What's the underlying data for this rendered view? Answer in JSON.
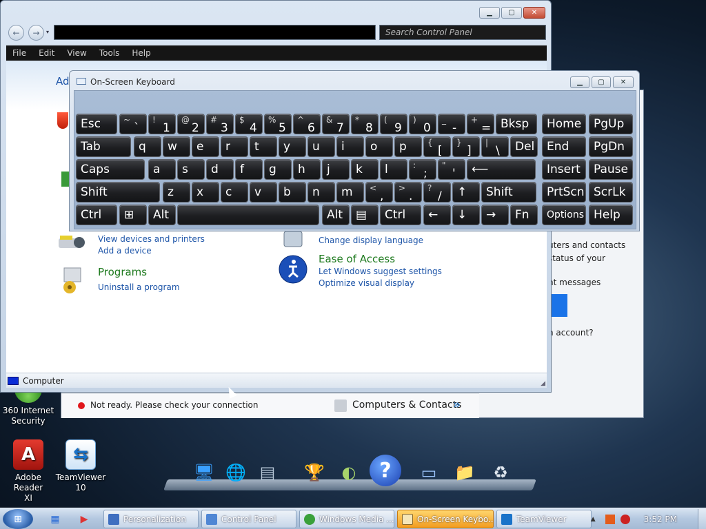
{
  "desktop": {
    "icons": [
      {
        "label_line1": "360 Internet",
        "label_line2": "Security"
      },
      {
        "label_line1": "Adobe Reader",
        "label_line2": "XI"
      },
      {
        "label_line1": "TeamViewer",
        "label_line2": "10"
      }
    ]
  },
  "control_panel": {
    "search_placeholder": "Search Control Panel",
    "menu": [
      "File",
      "Edit",
      "View",
      "Tools",
      "Help"
    ],
    "adjust_partial": "Adj",
    "hardware": {
      "link1": "View devices and printers",
      "link2": "Add a device"
    },
    "programs": {
      "title": "Programs",
      "link1": "Uninstall a program"
    },
    "clock": {
      "link1": "Change display language"
    },
    "ease": {
      "title": "Ease of Access",
      "link1": "Let Windows suggest settings",
      "link2": "Optimize visual display"
    },
    "status": "Computer"
  },
  "teamviewer": {
    "line1": "uters and contacts",
    "line2": "status of your",
    "line3": "nt messages",
    "line4": "n account?",
    "status_text": "Not ready. Please check your connection",
    "contacts_label": "Computers & Contacts",
    "contacts_chevron": "»"
  },
  "osk": {
    "title": "On-Screen Keyboard",
    "row1": [
      {
        "label": "Esc"
      },
      {
        "sub": "~",
        "main": "`"
      },
      {
        "sub": "!",
        "main": "1"
      },
      {
        "sub": "@",
        "main": "2"
      },
      {
        "sub": "#",
        "main": "3"
      },
      {
        "sub": "$",
        "main": "4"
      },
      {
        "sub": "%",
        "main": "5"
      },
      {
        "sub": "^",
        "main": "6"
      },
      {
        "sub": "&",
        "main": "7"
      },
      {
        "sub": "*",
        "main": "8"
      },
      {
        "sub": "(",
        "main": "9"
      },
      {
        "sub": ")",
        "main": "0"
      },
      {
        "sub": "_",
        "main": "-"
      },
      {
        "sub": "+",
        "main": "="
      },
      {
        "label": "Bksp"
      },
      {
        "label": "Home"
      },
      {
        "label": "PgUp"
      }
    ],
    "row2": [
      {
        "label": "Tab"
      },
      {
        "label": "q"
      },
      {
        "label": "w"
      },
      {
        "label": "e"
      },
      {
        "label": "r"
      },
      {
        "label": "t"
      },
      {
        "label": "y"
      },
      {
        "label": "u"
      },
      {
        "label": "i"
      },
      {
        "label": "o"
      },
      {
        "label": "p"
      },
      {
        "sub": "{",
        "main": "["
      },
      {
        "sub": "}",
        "main": "]"
      },
      {
        "sub": "|",
        "main": "\\"
      },
      {
        "label": "Del"
      },
      {
        "label": "End"
      },
      {
        "label": "PgDn"
      }
    ],
    "row3": [
      {
        "label": "Caps"
      },
      {
        "label": "a"
      },
      {
        "label": "s"
      },
      {
        "label": "d"
      },
      {
        "label": "f"
      },
      {
        "label": "g"
      },
      {
        "label": "h"
      },
      {
        "label": "j"
      },
      {
        "label": "k"
      },
      {
        "label": "l"
      },
      {
        "sub": ":",
        "main": ";"
      },
      {
        "sub": "\"",
        "main": "'"
      },
      {
        "label": "⟵"
      },
      {
        "label": "Insert"
      },
      {
        "label": "Pause"
      }
    ],
    "row4": [
      {
        "label": "Shift"
      },
      {
        "label": "z"
      },
      {
        "label": "x"
      },
      {
        "label": "c"
      },
      {
        "label": "v"
      },
      {
        "label": "b"
      },
      {
        "label": "n"
      },
      {
        "label": "m"
      },
      {
        "sub": "<",
        "main": ","
      },
      {
        "sub": ">",
        "main": "."
      },
      {
        "sub": "?",
        "main": "/"
      },
      {
        "label": "↑"
      },
      {
        "label": "Shift"
      },
      {
        "label": "PrtScn"
      },
      {
        "label": "ScrLk"
      }
    ],
    "row5": [
      {
        "label": "Ctrl"
      },
      {
        "label": "⊞"
      },
      {
        "label": "Alt"
      },
      {
        "label": ""
      },
      {
        "label": "Alt"
      },
      {
        "label": "▤"
      },
      {
        "label": "Ctrl"
      },
      {
        "label": "←"
      },
      {
        "label": "↓"
      },
      {
        "label": "→"
      },
      {
        "label": "Fn"
      },
      {
        "label": "Options"
      },
      {
        "label": "Help"
      }
    ]
  },
  "taskbar": {
    "tasks": [
      "Personalization",
      "Control Panel",
      "Windows Media ...",
      "On-Screen Keybo...",
      "TeamViewer"
    ],
    "clock": "3:52 PM",
    "tray_chevron": "▲"
  },
  "colors": {
    "accent_green": "#1e7a1e",
    "link_blue": "#1e55a8",
    "taskbar_active": "#f29c1f"
  }
}
